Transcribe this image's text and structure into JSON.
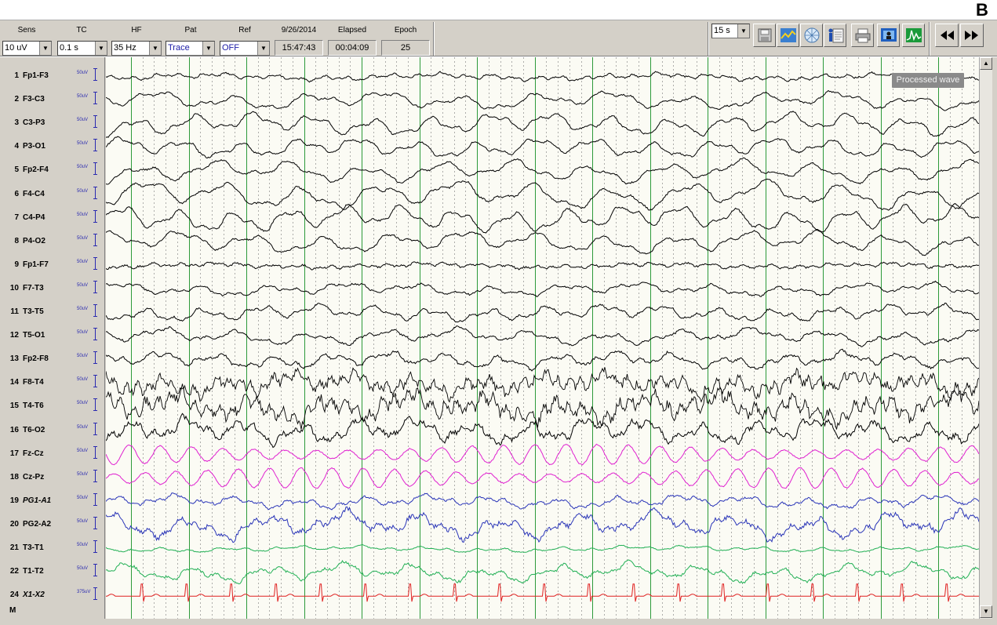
{
  "panel_letter": "B",
  "toolbar": {
    "sens": {
      "label": "Sens",
      "value": "10 uV"
    },
    "tc": {
      "label": "TC",
      "value": "0.1 s"
    },
    "hf": {
      "label": "HF",
      "value": "35 Hz"
    },
    "pat": {
      "label": "Pat",
      "value": "Trace"
    },
    "ref": {
      "label": "Ref",
      "value": "OFF"
    },
    "date": {
      "label": "9/26/2014",
      "value": "15:47:43"
    },
    "elapsed": {
      "label": "Elapsed",
      "value": "00:04:09"
    },
    "epoch": {
      "label": "Epoch",
      "value": "25"
    },
    "timebase": {
      "value": "15 s"
    },
    "icons": [
      "save-icon",
      "edit-wave-icon",
      "montage-grid-icon",
      "patient-info-icon",
      "print-icon",
      "video-icon",
      "spectrum-icon",
      "rewind-icon",
      "fast-forward-icon"
    ]
  },
  "processed_wave_label": "Processed wave",
  "m_label": "M",
  "channels": [
    {
      "num": "1",
      "name": "Fp1-F3",
      "scale": "50uV",
      "color": "#000000",
      "italic": false,
      "amp": 5,
      "noise": 0.4,
      "slow": 0.3
    },
    {
      "num": "2",
      "name": "F3-C3",
      "scale": "50uV",
      "color": "#000000",
      "italic": false,
      "amp": 9,
      "noise": 0.2,
      "slow": 0.7
    },
    {
      "num": "3",
      "name": "C3-P3",
      "scale": "50uV",
      "color": "#000000",
      "italic": false,
      "amp": 10,
      "noise": 0.2,
      "slow": 0.8
    },
    {
      "num": "4",
      "name": "P3-O1",
      "scale": "50uV",
      "color": "#000000",
      "italic": false,
      "amp": 9,
      "noise": 0.2,
      "slow": 0.8
    },
    {
      "num": "5",
      "name": "Fp2-F4",
      "scale": "50uV",
      "color": "#000000",
      "italic": false,
      "amp": 10,
      "noise": 0.2,
      "slow": 0.8
    },
    {
      "num": "6",
      "name": "F4-C4",
      "scale": "50uV",
      "color": "#000000",
      "italic": false,
      "amp": 12,
      "noise": 0.2,
      "slow": 0.9
    },
    {
      "num": "7",
      "name": "C4-P4",
      "scale": "50uV",
      "color": "#000000",
      "italic": false,
      "amp": 11,
      "noise": 0.2,
      "slow": 0.9
    },
    {
      "num": "8",
      "name": "P4-O2",
      "scale": "50uV",
      "color": "#000000",
      "italic": false,
      "amp": 10,
      "noise": 0.2,
      "slow": 0.8
    },
    {
      "num": "9",
      "name": "Fp1-F7",
      "scale": "50uV",
      "color": "#000000",
      "italic": false,
      "amp": 4,
      "noise": 0.6,
      "slow": 0.2
    },
    {
      "num": "10",
      "name": "F7-T3",
      "scale": "50uV",
      "color": "#000000",
      "italic": false,
      "amp": 7,
      "noise": 0.3,
      "slow": 0.6
    },
    {
      "num": "11",
      "name": "T3-T5",
      "scale": "50uV",
      "color": "#000000",
      "italic": false,
      "amp": 8,
      "noise": 0.3,
      "slow": 0.7
    },
    {
      "num": "12",
      "name": "T5-O1",
      "scale": "50uV",
      "color": "#000000",
      "italic": false,
      "amp": 8,
      "noise": 0.3,
      "slow": 0.7
    },
    {
      "num": "13",
      "name": "Fp2-F8",
      "scale": "50uV",
      "color": "#000000",
      "italic": false,
      "amp": 8,
      "noise": 0.4,
      "slow": 0.7
    },
    {
      "num": "14",
      "name": "F8-T4",
      "scale": "50uV",
      "color": "#000000",
      "italic": false,
      "amp": 11,
      "noise": 1.0,
      "slow": 0.6
    },
    {
      "num": "15",
      "name": "T4-T6",
      "scale": "50uV",
      "color": "#000000",
      "italic": false,
      "amp": 13,
      "noise": 1.0,
      "slow": 0.7
    },
    {
      "num": "16",
      "name": "T6-O2",
      "scale": "50uV",
      "color": "#000000",
      "italic": false,
      "amp": 11,
      "noise": 0.6,
      "slow": 0.8
    },
    {
      "num": "17",
      "name": "Fz-Cz",
      "scale": "50uV",
      "color": "#e020d0",
      "italic": false,
      "amp": 13,
      "noise": 0.1,
      "slow": 1.0
    },
    {
      "num": "18",
      "name": "Cz-Pz",
      "scale": "50uV",
      "color": "#e020d0",
      "italic": false,
      "amp": 13,
      "noise": 0.1,
      "slow": 1.0
    },
    {
      "num": "19",
      "name": "PG1-A1",
      "scale": "50uV",
      "color": "#2a35b8",
      "italic": true,
      "amp": 7,
      "noise": 0.4,
      "slow": 0.6
    },
    {
      "num": "20",
      "name": "PG2-A2",
      "scale": "50uV",
      "color": "#2a35b8",
      "italic": false,
      "amp": 12,
      "noise": 0.5,
      "slow": 0.8
    },
    {
      "num": "21",
      "name": "T3-T1",
      "scale": "50uV",
      "color": "#22b055",
      "italic": false,
      "amp": 4,
      "noise": 0.3,
      "slow": 0.4
    },
    {
      "num": "22",
      "name": "T1-T2",
      "scale": "50uV",
      "color": "#22b055",
      "italic": false,
      "amp": 9,
      "noise": 0.4,
      "slow": 0.7
    },
    {
      "num": "24",
      "name": "X1-X2",
      "scale": "375uV",
      "color": "#e02020",
      "italic": true,
      "amp": 14,
      "noise": 0.0,
      "slow": 0.0,
      "ecg": true
    }
  ]
}
